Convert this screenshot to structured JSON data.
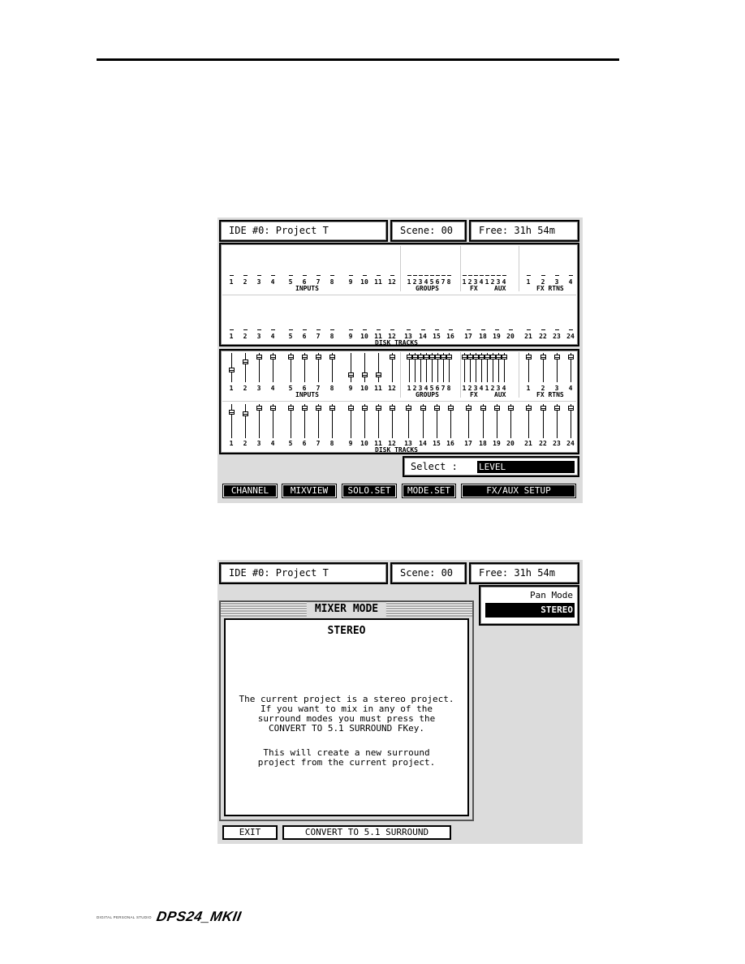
{
  "brand": {
    "tagline": "DIGITAL PERSONAL STUDIO",
    "model": "DPS24_MKII"
  },
  "screen1": {
    "header": {
      "title": "IDE #0: Project T",
      "scene": "Scene: 00",
      "free": "Free: 31h 54m"
    },
    "meter_panel": {
      "row1": {
        "inputs": [
          "1",
          "2",
          "3",
          "4",
          "5",
          "6",
          "7",
          "8",
          "9",
          "10",
          "11",
          "12"
        ],
        "groups": [
          "1",
          "2",
          "3",
          "4",
          "5",
          "6",
          "7",
          "8"
        ],
        "fx": [
          "1",
          "2",
          "3",
          "4"
        ],
        "aux": [
          "1",
          "2",
          "3",
          "4"
        ],
        "fx_rtns": [
          "1",
          "2",
          "3",
          "4"
        ],
        "labels": {
          "inputs": "INPUTS",
          "groups": "GROUPS",
          "fx": "FX",
          "aux": "AUX",
          "fx_rtns": "FX RTNS"
        }
      },
      "row2": {
        "tracks": [
          "1",
          "2",
          "3",
          "4",
          "5",
          "6",
          "7",
          "8",
          "9",
          "10",
          "11",
          "12",
          "13",
          "14",
          "15",
          "16",
          "17",
          "18",
          "19",
          "20",
          "21",
          "22",
          "23",
          "24"
        ],
        "label": "DISK TRACKS"
      }
    },
    "fader_panel": {
      "row1": {
        "inputs_levels": [
          0.4,
          0.75,
          0.95,
          0.95,
          0.95,
          0.95,
          0.95,
          0.95,
          0.2,
          0.2,
          0.2,
          0.95
        ],
        "groups_levels": [
          0.95,
          0.95,
          0.95,
          0.95,
          0.95,
          0.95,
          0.95,
          0.95
        ],
        "fx_levels": [
          0.95,
          0.95,
          0.95,
          0.95
        ],
        "aux_levels": [
          0.95,
          0.95,
          0.95,
          0.95
        ],
        "fx_rtns_levels": [
          0.95,
          0.95,
          0.95,
          0.95
        ]
      },
      "row2": {
        "tracks_levels": [
          0.8,
          0.75,
          0.95,
          0.95,
          0.95,
          0.95,
          0.95,
          0.95,
          0.95,
          0.95,
          0.95,
          0.95,
          0.95,
          0.95,
          0.95,
          0.95,
          0.95,
          0.95,
          0.95,
          0.95,
          0.95,
          0.95,
          0.95,
          0.95
        ]
      }
    },
    "select": {
      "label": "Select :",
      "value": "LEVEL"
    },
    "fkeys": [
      "CHANNEL",
      "MIXVIEW",
      "SOLO.SET",
      "MODE.SET",
      "FX/AUX SETUP"
    ]
  },
  "screen2": {
    "header": {
      "title": "IDE #0: Project T",
      "scene": "Scene: 00",
      "free": "Free: 31h 54m"
    },
    "mixer_mode": {
      "title": "MIXER MODE",
      "mode": "STEREO",
      "message1": "The current project is a stereo project.\nIf you want to mix in any of the\nsurround modes you must press the\nCONVERT TO 5.1 SURROUND FKey.",
      "message2": "This will create a new surround\nproject from the current project."
    },
    "pan_mode": {
      "label": "Pan Mode",
      "value": "STEREO"
    },
    "fkeys": [
      "EXIT",
      "CONVERT TO 5.1 SURROUND"
    ]
  }
}
